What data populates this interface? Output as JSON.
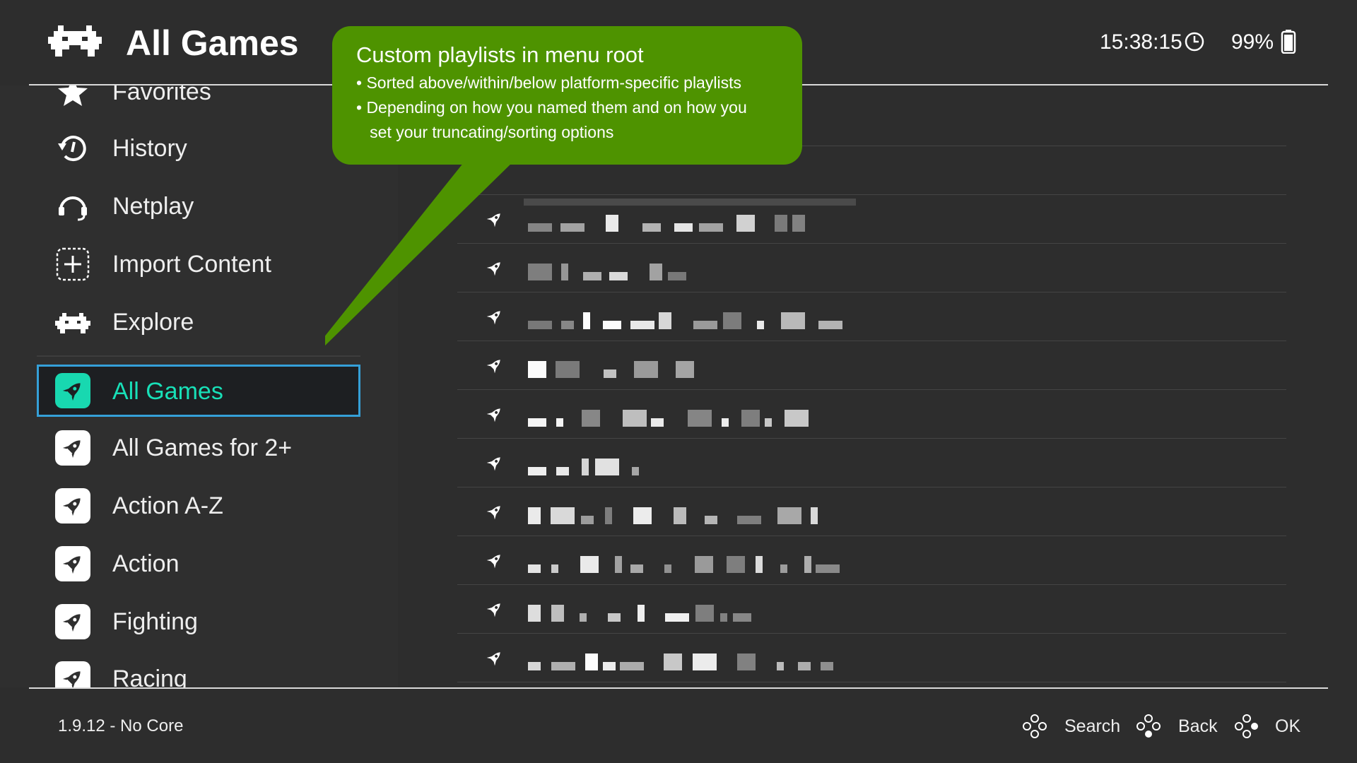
{
  "header": {
    "title": "All Games",
    "logo_icon": "retroarch-invader-icon",
    "clock": "15:38:15",
    "clock_icon": "clock-icon",
    "battery": "99%",
    "battery_icon": "battery-icon"
  },
  "sidebar": {
    "items": [
      {
        "label": "Favorites",
        "icon": "star-icon"
      },
      {
        "label": "History",
        "icon": "history-icon"
      },
      {
        "label": "Netplay",
        "icon": "netplay-headset-icon"
      },
      {
        "label": "Import Content",
        "icon": "add-content-icon"
      },
      {
        "label": "Explore",
        "icon": "explore-invader-icon"
      }
    ],
    "playlists": [
      {
        "label": "All Games",
        "icon": "rocket-playlist-icon",
        "selected": true
      },
      {
        "label": "All Games for 2+",
        "icon": "rocket-playlist-icon"
      },
      {
        "label": "Action A-Z",
        "icon": "rocket-playlist-icon"
      },
      {
        "label": "Action",
        "icon": "rocket-playlist-icon"
      },
      {
        "label": "Fighting",
        "icon": "rocket-playlist-icon"
      },
      {
        "label": "Racing",
        "icon": "rocket-playlist-icon"
      }
    ]
  },
  "callout": {
    "title": "Custom playlists in menu root",
    "bullets": [
      "• Sorted above/within/below platform-specific playlists",
      "• Depending on how you named them and on how you",
      "   set your truncating/sorting options"
    ],
    "color": "#4e9300"
  },
  "main": {
    "row_icon": "rocket-icon",
    "rows": 10
  },
  "footer": {
    "version": "1.9.12 - No Core",
    "buttons": [
      {
        "label": "Search",
        "icon": "gamepad-button-icon"
      },
      {
        "label": "Back",
        "icon": "gamepad-button-icon"
      },
      {
        "label": "OK",
        "icon": "gamepad-button-icon"
      }
    ]
  },
  "colors": {
    "background": "#2d2d2d",
    "selected_text": "#18e0b8",
    "selected_border": "#35a0d8",
    "callout": "#4e9300"
  }
}
